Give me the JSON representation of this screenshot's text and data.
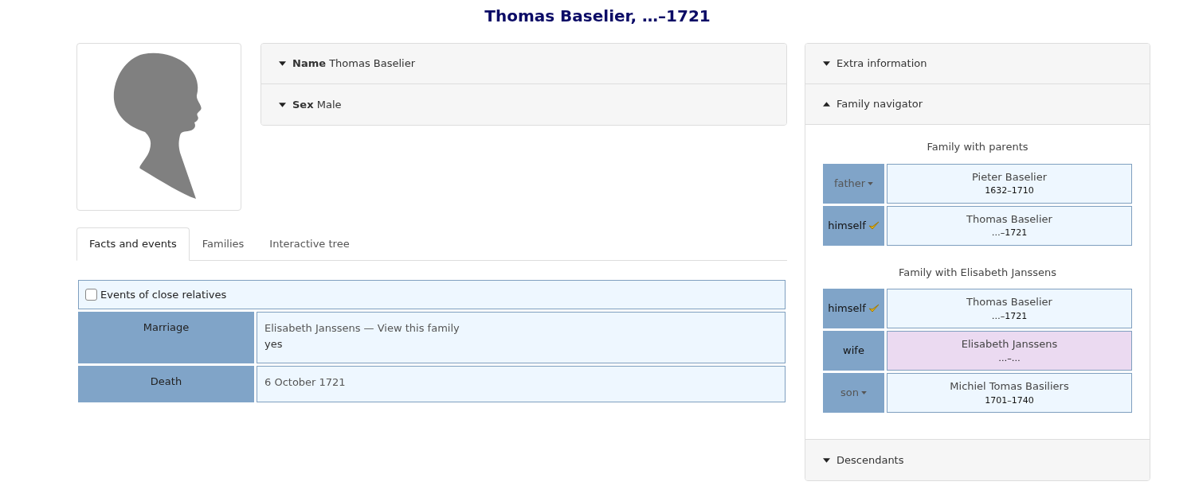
{
  "title": "Thomas Baselier, …–1721",
  "facts_accordion": [
    {
      "label": "Name",
      "value": "Thomas Baselier",
      "expanded": false
    },
    {
      "label": "Sex",
      "value": "Male",
      "expanded": false
    }
  ],
  "tabs": [
    {
      "label": "Facts and events",
      "selected": true
    },
    {
      "label": "Families",
      "selected": false
    },
    {
      "label": "Interactive tree",
      "selected": false
    }
  ],
  "close_relatives": {
    "label": "Events of close relatives",
    "checked": false
  },
  "events": [
    {
      "event": "Marriage",
      "lines": [
        "Elisabeth Janssens — View this family",
        "yes"
      ]
    },
    {
      "event": "Death",
      "lines": [
        "6 October 1721"
      ]
    }
  ],
  "sidebar": [
    {
      "label": "Extra information",
      "expanded": false
    },
    {
      "label": "Family navigator",
      "expanded": true,
      "families": [
        {
          "heading": "Family with parents",
          "members": [
            {
              "role": "father",
              "kind": "menu",
              "name": "Pieter Baselier",
              "dates": "1632–1710",
              "color": "#eef7ff"
            },
            {
              "role": "himself",
              "kind": "self",
              "name": "Thomas Baselier",
              "dates": "…–1721",
              "color": "#eef7ff"
            }
          ]
        },
        {
          "heading": "Family with Elisabeth Janssens",
          "members": [
            {
              "role": "himself",
              "kind": "self",
              "name": "Thomas Baselier",
              "dates": "…–1721",
              "color": "#eef7ff"
            },
            {
              "role": "wife",
              "kind": "plain",
              "name": "Elisabeth Janssens",
              "dates": "…–…",
              "color": "#ebdaf1"
            },
            {
              "role": "son",
              "kind": "menu",
              "name": "Michiel Tomas Basiliers",
              "dates": "1701–1740",
              "color": "#eef7ff"
            }
          ]
        }
      ]
    },
    {
      "label": "Descendants",
      "expanded": false
    }
  ]
}
